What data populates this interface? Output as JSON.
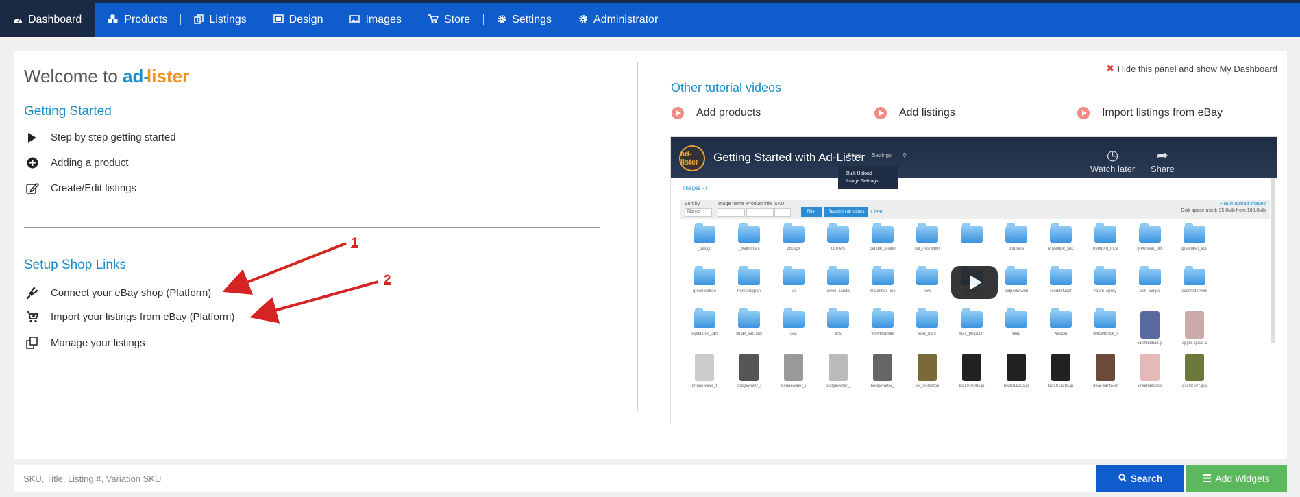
{
  "nav": {
    "items": [
      {
        "label": "Dashboard",
        "icon": "dashboard-icon"
      },
      {
        "label": "Products",
        "icon": "cubes-icon"
      },
      {
        "label": "Listings",
        "icon": "copy-icon"
      },
      {
        "label": "Design",
        "icon": "design-icon"
      },
      {
        "label": "Images",
        "icon": "image-icon"
      },
      {
        "label": "Store",
        "icon": "cart-icon"
      },
      {
        "label": "Settings",
        "icon": "gear-icon"
      },
      {
        "label": "Administrator",
        "icon": "gear-icon"
      }
    ]
  },
  "welcome": {
    "prefix": "Welcome to",
    "brand_ad": "ad-",
    "brand_lister": "lister"
  },
  "getting_started": {
    "title": "Getting Started",
    "items": [
      "Step by step getting started",
      "Adding a product",
      "Create/Edit listings"
    ]
  },
  "setup": {
    "title": "Setup Shop Links",
    "items": [
      "Connect your eBay shop (Platform)",
      "Import your listings from eBay (Platform)",
      "Manage your listings"
    ]
  },
  "annotations": [
    "1",
    "2"
  ],
  "hide_panel": "Hide this panel and show My Dashboard",
  "tutorials": {
    "title": "Other tutorial videos",
    "items": [
      "Add products",
      "Add listings",
      "Import listings from eBay"
    ]
  },
  "video": {
    "title": "Getting Started with Ad-Lister",
    "logo": "ad-lister",
    "menu": [
      "Store",
      "Settings"
    ],
    "dropdown": [
      "Bulk Upload",
      "Image Settings"
    ],
    "watch_later": "Watch later",
    "share": "Share",
    "crumb": "Images - /",
    "filter_labels": [
      "Sort by",
      "Image name",
      "Product title",
      "SKU"
    ],
    "sort_value": "Name",
    "filter_btn": "Filter",
    "search_all_btn": "Search in all folders",
    "clear": "Clear",
    "bulk_upload": "+ Bulk upload images",
    "disk_space": "Disk space used: 35.8Mb from 100.0Mb",
    "rows": [
      [
        "_design",
        "_watermark",
        "1600px",
        "burners",
        "candle_shade",
        "car_freshener",
        "",
        "diffusers",
        "envelope_sac",
        "freedom_ince",
        "greenleaf_oils",
        "greenleaf_voti"
      ],
      [
        "greenleafroo",
        "homefragran",
        "jar",
        "jewell_candle",
        "matchbox_inc",
        "new",
        "potpourri",
        "potpourriwith",
        "reeddiffuser",
        "room_spray",
        "salt_lamps",
        "scentedervelc"
      ],
      [
        "signature_can",
        "small_sachets",
        "test",
        "tins",
        "votivecandle",
        "wax_bars",
        "wax_potpourr",
        "Web",
        "webcat",
        "willowbrook_f",
        "51nhbolball.jp",
        "apple-spice-&"
      ],
      [
        "bridgewater_f",
        "bridgewater_r",
        "bridgewater_j",
        "bridgewater_j",
        "bridgewater_",
        "bw_mistletoe",
        "bw101008s.jp",
        "bw101125s.jp",
        "bw101128s.jp",
        "dear-santa-sr",
        "dreamblosso",
        "dsc02107.jpg"
      ]
    ]
  },
  "search": {
    "placeholder": "SKU, Title, Listing #, Variation SKU",
    "search_label": "Search",
    "widgets_label": "Add Widgets"
  },
  "colors": {
    "nav": "#0f5ccc",
    "nav_active": "#1b2a44",
    "accent": "#1a8ec9",
    "brand_orange": "#f0921d",
    "green": "#5cb85c",
    "annotation_red": "#d42424"
  }
}
